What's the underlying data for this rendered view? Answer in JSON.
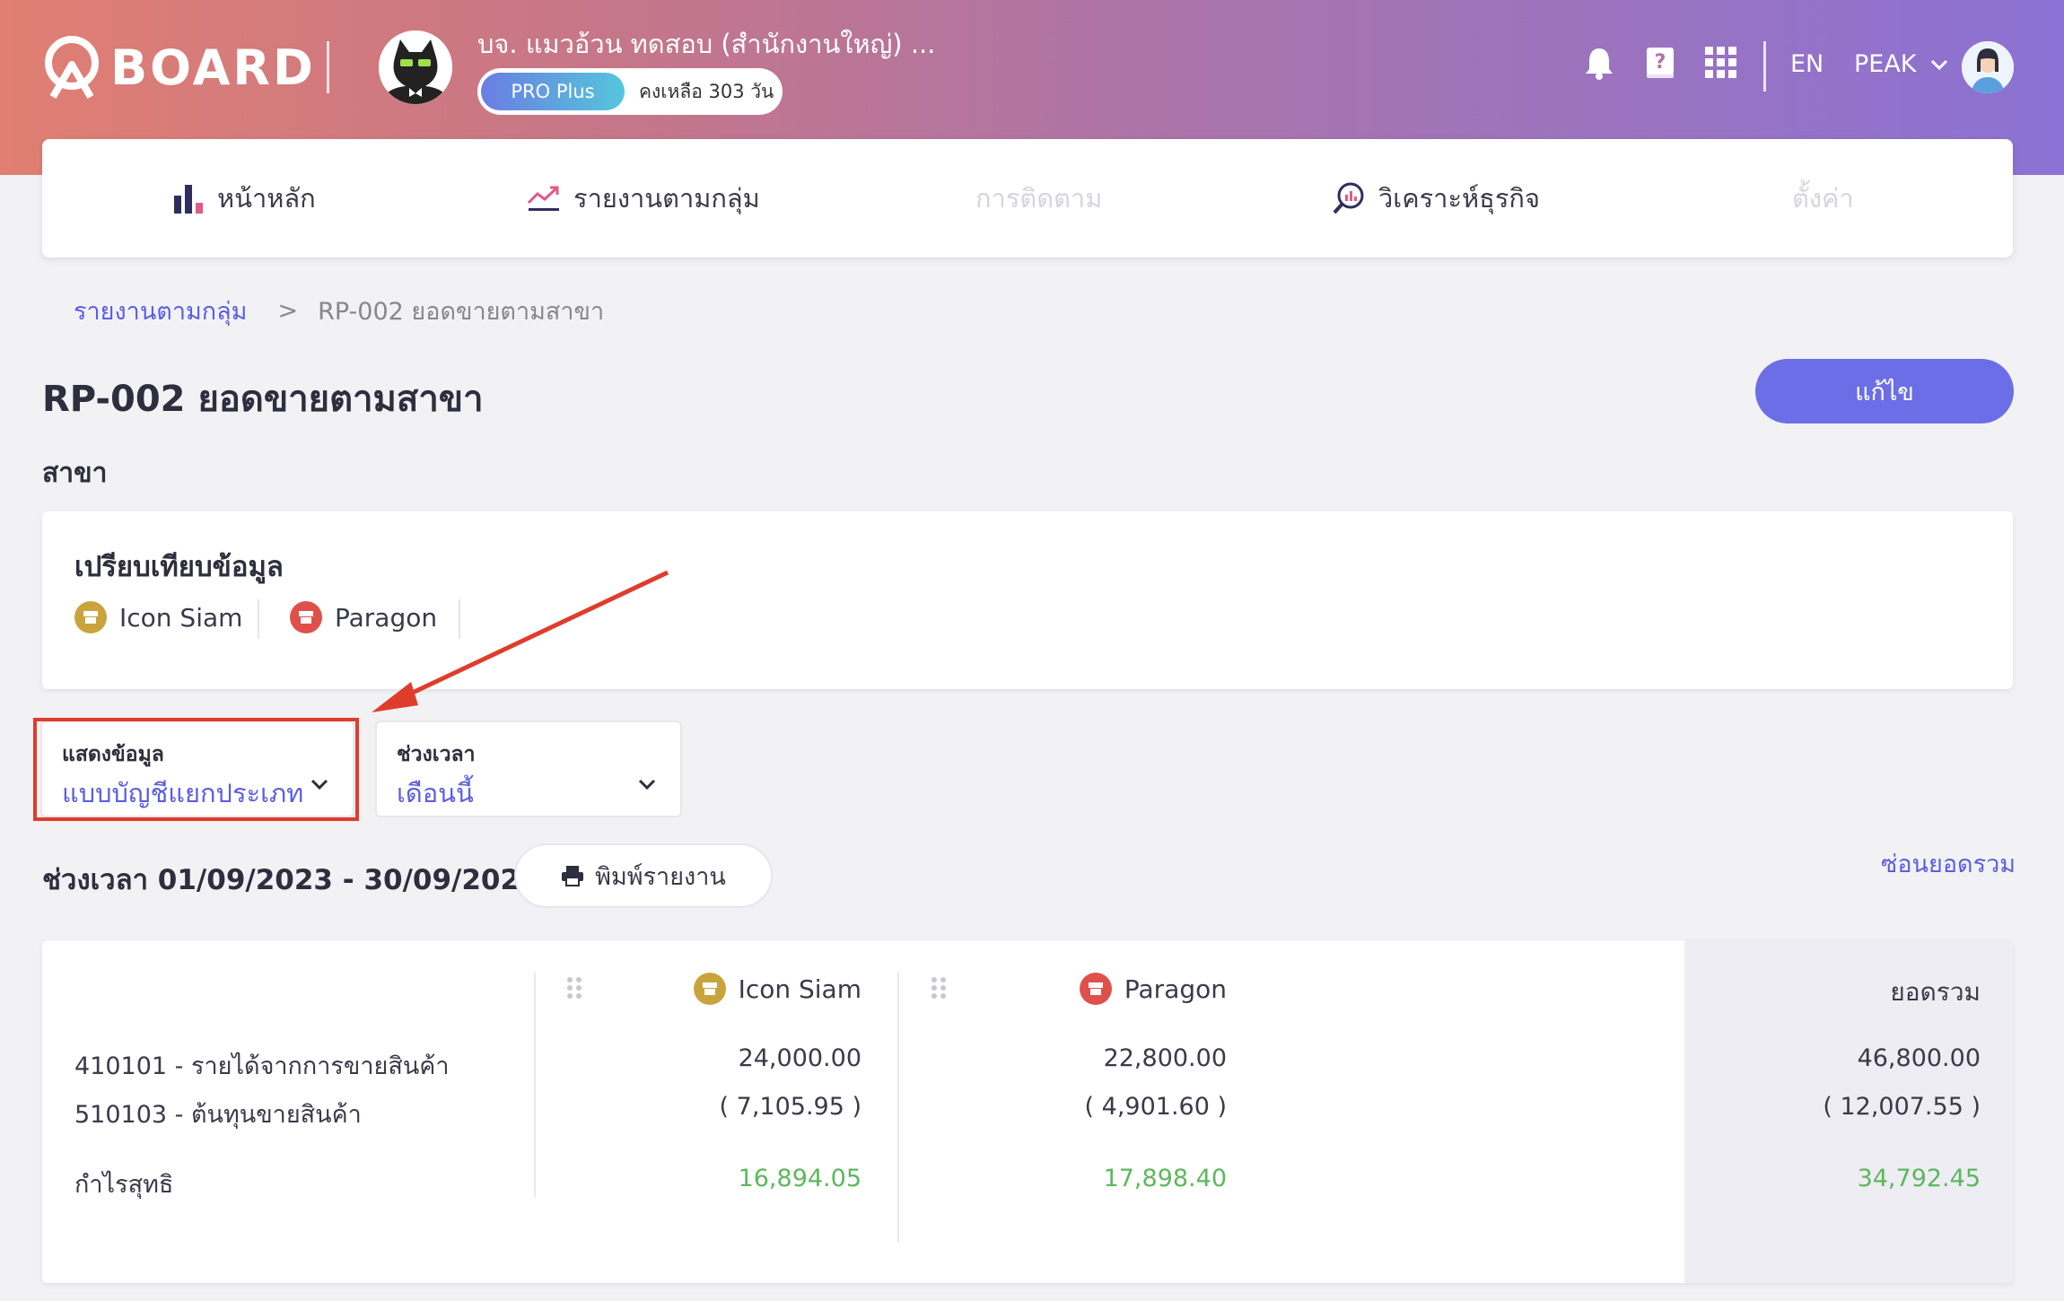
{
  "header": {
    "logo_text": "BOARD",
    "company_name": "บจ. แมวอ้วน ทดสอบ (สำนักงานใหญ่) ...",
    "plan_badge": "PRO Plus",
    "plan_remaining": "คงเหลือ 303 วัน",
    "language": "EN",
    "account_menu": "PEAK"
  },
  "nav": {
    "items": [
      {
        "label": "หน้าหลัก",
        "icon": "bar-chart-icon",
        "enabled": true
      },
      {
        "label": "รายงานตามกลุ่ม",
        "icon": "trend-up-icon",
        "enabled": true
      },
      {
        "label": "การติดตาม",
        "icon": "",
        "enabled": false
      },
      {
        "label": "วิเคราะห์ธุรกิจ",
        "icon": "magnify-chart-icon",
        "enabled": true
      },
      {
        "label": "ตั้งค่า",
        "icon": "",
        "enabled": false
      }
    ]
  },
  "breadcrumb": {
    "parent": "รายงานตามกลุ่ม",
    "separator": ">",
    "current": "RP-002 ยอดขายตามสาขา"
  },
  "page": {
    "title": "RP-002 ยอดขายตามสาขา",
    "edit_label": "แก้ไข",
    "section_label": "สาขา"
  },
  "compare": {
    "title": "เปรียบเทียบข้อมูล",
    "branches": [
      {
        "name": "Icon Siam",
        "color": "#c9a43c"
      },
      {
        "name": "Paragon",
        "color": "#e0504a"
      }
    ]
  },
  "filters": {
    "display": {
      "label": "แสดงข้อมูล",
      "value": "แบบบัญชีแยกประเภท"
    },
    "period": {
      "label": "ช่วงเวลา",
      "value": "เดือนนี้"
    }
  },
  "report": {
    "period_text": "ช่วงเวลา 01/09/2023 - 30/09/2023",
    "print_label": "พิมพ์รายงาน",
    "hide_total_label": "ซ่อนยอดรวม"
  },
  "table": {
    "columns": [
      "Icon Siam",
      "Paragon",
      "ยอดรวม"
    ],
    "rows": [
      {
        "account": "410101 - รายได้จากการขายสินค้า",
        "values": [
          "24,000.00",
          "22,800.00",
          "46,800.00"
        ]
      },
      {
        "account": "510103 - ต้นทุนขายสินค้า",
        "values": [
          "( 7,105.95 )",
          "( 4,901.60 )",
          "( 12,007.55 )"
        ]
      }
    ],
    "net": {
      "label": "กำไรสุทธิ",
      "values": [
        "16,894.05",
        "17,898.40",
        "34,792.45"
      ]
    }
  },
  "colors": {
    "accent": "#5a5ee0",
    "button": "#6b6ee6",
    "positive": "#5cb85c",
    "highlight": "#e03c2c"
  }
}
